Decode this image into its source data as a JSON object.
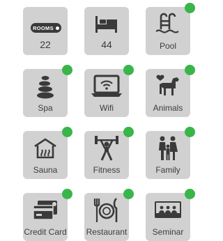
{
  "tiles": {
    "rooms": {
      "badge": "ROOMS",
      "value": "22",
      "active": false
    },
    "beds": {
      "value": "44",
      "active": false
    },
    "pool": {
      "label": "Pool",
      "active": true
    },
    "spa": {
      "label": "Spa",
      "active": true
    },
    "wifi": {
      "label": "Wifi",
      "active": true
    },
    "animals": {
      "label": "Animals",
      "active": true
    },
    "sauna": {
      "label": "Sauna",
      "active": true
    },
    "fitness": {
      "label": "Fitness",
      "active": true
    },
    "family": {
      "label": "Family",
      "active": true
    },
    "credit_card": {
      "label": "Credit Card",
      "active": true
    },
    "restaurant": {
      "label": "Restaurant",
      "active": true
    },
    "seminar": {
      "label": "Seminar",
      "active": true
    }
  },
  "colors": {
    "tile_bg": "#d1d1d1",
    "icon": "#3a3a3a",
    "active_dot": "#39b54a",
    "text": "#3d3d3d"
  }
}
